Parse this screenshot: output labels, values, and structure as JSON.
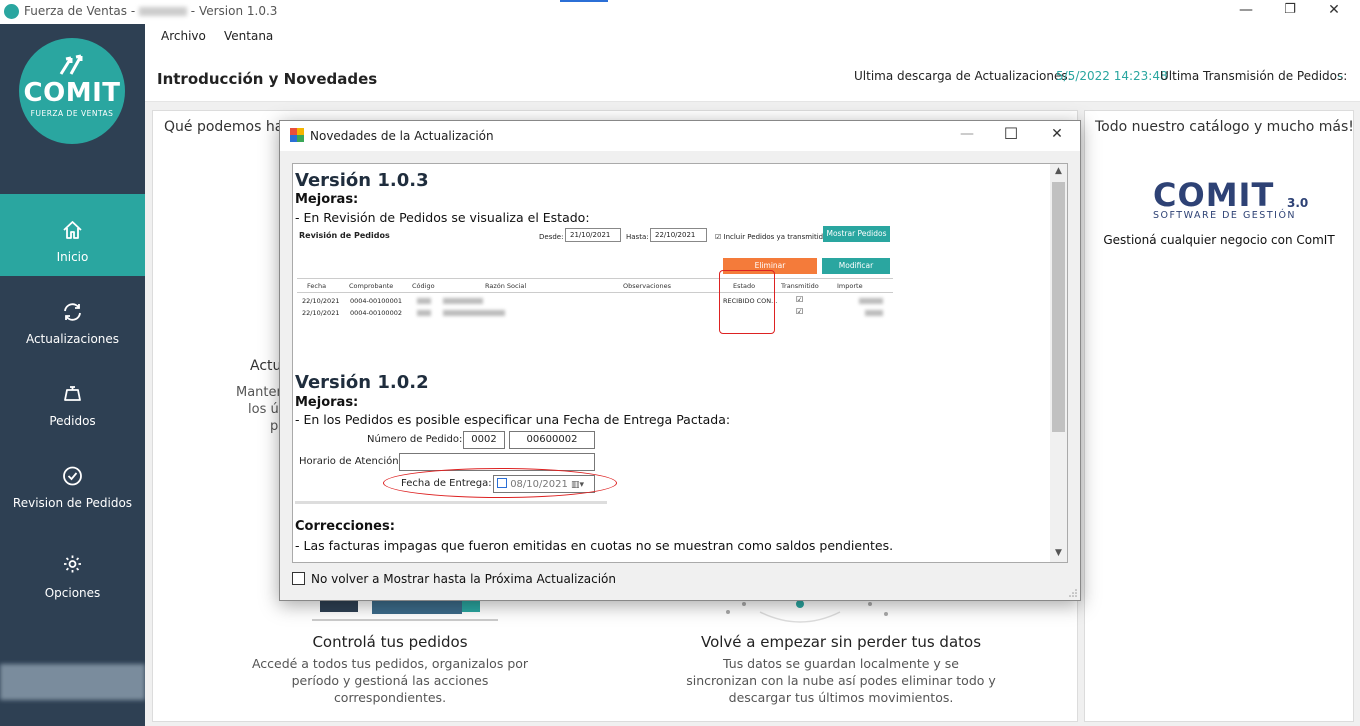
{
  "window": {
    "title_prefix": "Fuerza de Ventas - ",
    "title_suffix": " - Version 1.0.3",
    "minimize": "—",
    "maximize": "❐",
    "close": "✕"
  },
  "menu": {
    "items": [
      "Archivo",
      "Ventana"
    ]
  },
  "header": {
    "page_title": "Introducción y Novedades",
    "last_download_label": "Ultima descarga de Actualizaciones:",
    "last_download_value": "5/5/2022 14:23:48",
    "last_transmission_label": "Ultima Transmisión de Pedidos:",
    "last_transmission_value": "-"
  },
  "sidebar": {
    "logo_main": "COMIT",
    "logo_sub": "FUERZA DE VENTAS",
    "items": [
      {
        "label": "Inicio",
        "icon": "home-icon",
        "active": true
      },
      {
        "label": "Actualizaciones",
        "icon": "refresh-icon",
        "active": false
      },
      {
        "label": "Pedidos",
        "icon": "scale-icon",
        "active": false
      },
      {
        "label": "Revision de Pedidos",
        "icon": "check-circle-icon",
        "active": false
      },
      {
        "label": "Opciones",
        "icon": "gear-icon",
        "active": false
      }
    ]
  },
  "main": {
    "left_heading_partial": "Qué podemos ha",
    "partial_actu": "Actu",
    "partial_lines": [
      "Manten",
      "los úl",
      "p"
    ],
    "features": [
      {
        "title": "Controlá tus pedidos",
        "desc": "Accedé a todos tus pedidos, organizalos por período y gestioná las acciones correspondientes."
      },
      {
        "title": "Volvé a empezar sin perder tus datos",
        "desc": "Tus datos se guardan localmente y se sincronizan con la nube así podes eliminar todo y descargar tus últimos movimientos."
      }
    ],
    "right_heading": "Todo nuestro catálogo y mucho más!",
    "comit30_main": "COMIT",
    "comit30_version": "3.0",
    "comit30_sub": "SOFTWARE DE GESTIÓN",
    "comit30_tagline": "Gestioná cualquier negocio con ComIT"
  },
  "dialog": {
    "title": "Novedades de la Actualización",
    "minimize": "—",
    "maximize": "☐",
    "close": "✕",
    "checkbox_label": "No volver a Mostrar hasta la Próxima Actualización",
    "checkbox_checked": false,
    "content": {
      "v103_title": "Versión 1.0.3",
      "v103_mejoras": "Mejoras:",
      "v103_item": "- En Revisión de Pedidos se visualiza el Estado:",
      "v102_title": "Versión 1.0.2",
      "v102_mejoras": "Mejoras:",
      "v102_item": "- En los Pedidos es posible especificar una Fecha de Entrega Pactada:",
      "correcciones": "Correcciones:",
      "correcciones_item": "- Las facturas impagas que fueron emitidas en cuotas no se muestran como saldos pendientes."
    },
    "shot1": {
      "title": "Revisión de Pedidos",
      "desde_label": "Desde:",
      "desde_value": "21/10/2021",
      "hasta_label": "Hasta:",
      "hasta_value": "22/10/2021",
      "incluir_label": "Incluir Pedidos ya transmitidos",
      "mostrar_btn": "Mostrar Pedidos",
      "eliminar_btn": "Eliminar",
      "modificar_btn": "Modificar",
      "columns": [
        "Fecha",
        "Comprobante",
        "Código",
        "Razón Social",
        "Observaciones",
        "Estado",
        "Transmitido",
        "Importe"
      ],
      "rows": [
        {
          "fecha": "22/10/2021",
          "comprobante": "0004-00100001",
          "estado": "RECIBIDO CON..."
        },
        {
          "fecha": "22/10/2021",
          "comprobante": "0004-00100002",
          "estado": ""
        }
      ]
    },
    "shot2": {
      "numero_label": "Número de Pedido:",
      "numero_pv": "0002",
      "numero_nro": "00600002",
      "horario_label": "Horario de Atención:",
      "fecha_label": "Fecha de Entrega:",
      "fecha_value": "08/10/2021"
    }
  }
}
